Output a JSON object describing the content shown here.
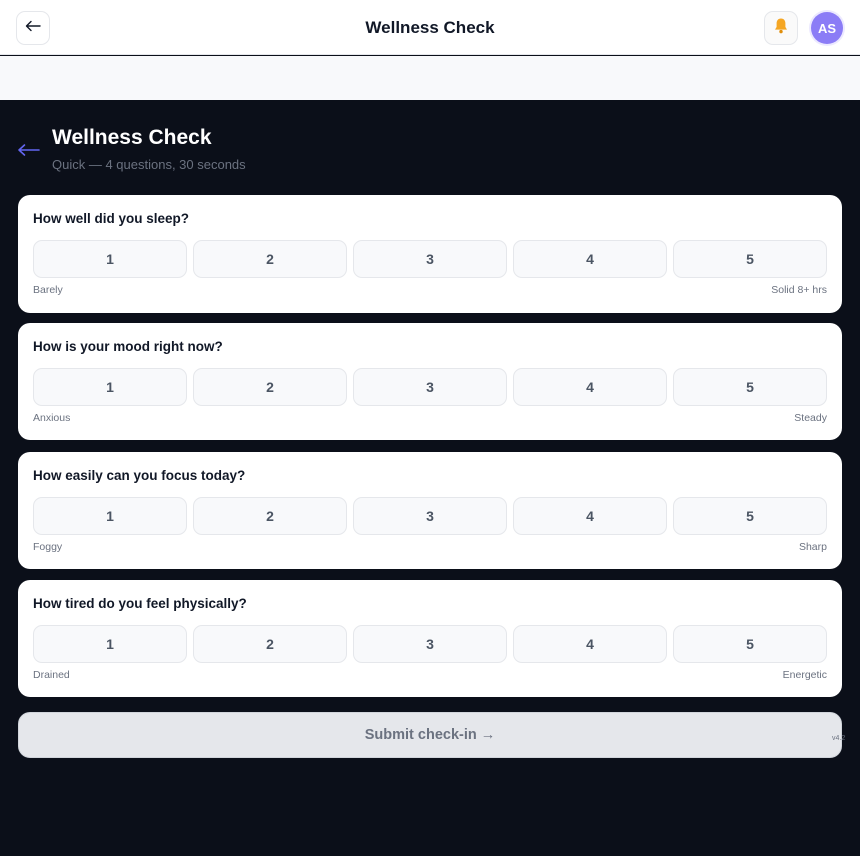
{
  "app": {
    "title": "Wellness Check",
    "avatar_initials": "AS",
    "back_icon": "arrow-left-icon",
    "notification_icon": "bell-icon"
  },
  "page": {
    "title": "Wellness Check",
    "subtitle": "Quick — 4 questions, 30 seconds"
  },
  "questions": [
    {
      "prompt": "How well did you sleep?",
      "low_label": "Barely",
      "high_label": "Solid 8+ hrs",
      "options": [
        "1",
        "2",
        "3",
        "4",
        "5"
      ]
    },
    {
      "prompt": "How is your mood right now?",
      "low_label": "Anxious",
      "high_label": "Steady",
      "options": [
        "1",
        "2",
        "3",
        "4",
        "5"
      ]
    },
    {
      "prompt": "How easily can you focus today?",
      "low_label": "Foggy",
      "high_label": "Sharp",
      "options": [
        "1",
        "2",
        "3",
        "4",
        "5"
      ]
    },
    {
      "prompt": "How tired do you feel physically?",
      "low_label": "Drained",
      "high_label": "Energetic",
      "options": [
        "1",
        "2",
        "3",
        "4",
        "5"
      ]
    }
  ],
  "submit_label": "Submit check-in →",
  "version": "v4.2",
  "colors": {
    "accent": "#6366f1",
    "avatar": "#8b7cf6",
    "dark_bg": "#0b0f19",
    "bell": "#f59e0b"
  }
}
